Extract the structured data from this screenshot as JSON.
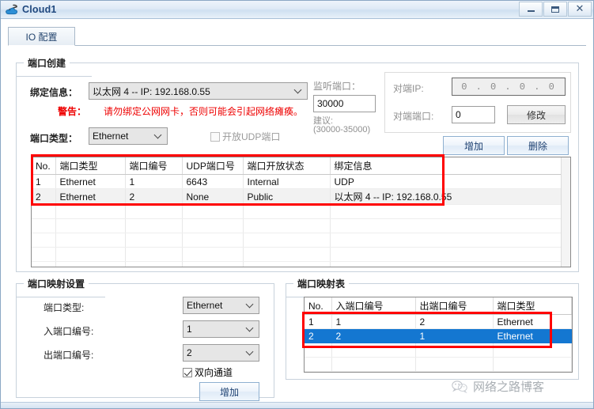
{
  "window": {
    "title": "Cloud1",
    "icon": "cloud-network-icon",
    "minimize_label": "–",
    "maximize_label": "❐",
    "close_label": "✕"
  },
  "tabs": [
    {
      "label": "IO 配置",
      "active": true
    }
  ],
  "port_create": {
    "title": "端口创建",
    "bind_info_label": "绑定信息：",
    "bind_info_value": "以太网 4 -- IP: 192.168.0.55",
    "warning_label": "警告：",
    "warning_text": "请勿绑定公网网卡，否则可能会引起网络瘫痪。",
    "warning_color": "#ee0000",
    "port_type_label": "端口类型：",
    "port_type_value": "Ethernet",
    "udp_checkbox_label": "开放UDP端口",
    "udp_checkbox_checked": false,
    "listen_port_label": "监听端口：",
    "listen_port_value": "30000",
    "suggest_label": "建议:",
    "suggest_range": "(30000-35000)",
    "peer_ip_label": "对端IP:",
    "peer_ip_value": "0 . 0 . 0 . 0",
    "peer_port_label": "对端端口:",
    "peer_port_value": "0",
    "modify_button": "修改",
    "add_button": "增加",
    "delete_button": "删除"
  },
  "port_table": {
    "columns": [
      "No.",
      "端口类型",
      "端口编号",
      "UDP端口号",
      "端口开放状态",
      "绑定信息"
    ],
    "rows": [
      {
        "no": "1",
        "type": "Ethernet",
        "number": "1",
        "udp_port": "6643",
        "state": "Internal",
        "bind": "UDP"
      },
      {
        "no": "2",
        "type": "Ethernet",
        "number": "2",
        "udp_port": "None",
        "state": "Public",
        "bind": "以太网 4 -- IP: 192.168.0.55"
      }
    ]
  },
  "mapping_settings": {
    "title": "端口映射设置",
    "port_type_label": "端口类型:",
    "port_type_value": "Ethernet",
    "in_port_label": "入端口编号:",
    "in_port_value": "1",
    "out_port_label": "出端口编号:",
    "out_port_value": "2",
    "bidirectional_label": "双向通道",
    "bidirectional_checked": true,
    "add_button": "增加"
  },
  "mapping_table": {
    "title": "端口映射表",
    "columns": [
      "No.",
      "入端口编号",
      "出端口编号",
      "端口类型"
    ],
    "rows": [
      {
        "no": "1",
        "in": "1",
        "out": "2",
        "type": "Ethernet",
        "selected": false
      },
      {
        "no": "2",
        "in": "2",
        "out": "1",
        "type": "Ethernet",
        "selected": true
      }
    ]
  },
  "watermark": {
    "text": "网络之路博客",
    "icon": "wechat-icon"
  }
}
